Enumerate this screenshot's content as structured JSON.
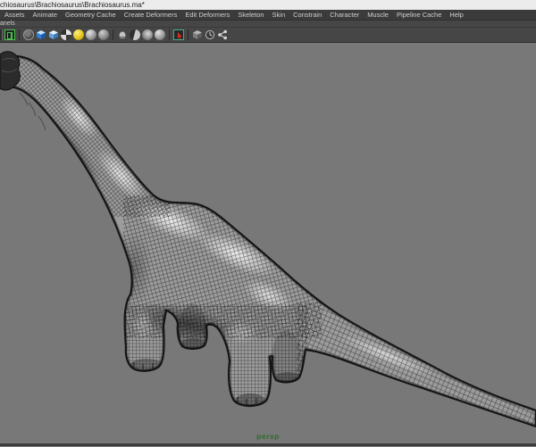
{
  "window": {
    "title": "chiosaurus\\Brachiosaurus\\Brachiosaurus.ma*"
  },
  "menu_bar": {
    "items": [
      "Assets",
      "Animate",
      "Geometry Cache",
      "Create Deformers",
      "Edit Deformers",
      "Skeleton",
      "Skin",
      "Constrain",
      "Character",
      "Muscle",
      "Pipeline Cache",
      "Help"
    ]
  },
  "panel_menu": {
    "visible_label": "anels"
  },
  "panel_toolbar": {
    "icons": [
      "panel-layout-icon",
      "wireframe-sphere-icon",
      "shaded-cube-icon",
      "textured-cube-icon",
      "checker-sphere-icon",
      "all-lights-icon",
      "flat-light-sphere-icon",
      "no-lights-sphere-icon",
      "shadows-lamp-icon",
      "ao-sphere-icon",
      "half-shade-sphere-icon",
      "multisample-sphere-icon",
      "isolate-select-icon",
      "xray-cube-icon",
      "exposure-clock-icon",
      "node-share-icon"
    ]
  },
  "viewport": {
    "camera_label": "persp",
    "model": "brachiosaurus-wireframe-mesh"
  },
  "colors": {
    "titlebar_bg": "#ececec",
    "menu_bg": "#3b3b3b",
    "toolbar_bg": "#464646",
    "viewport_bg": "#787878",
    "accent_green": "#49c24f",
    "persp_label_green": "#2a6e2a",
    "mesh_base_gray": "#9c9c9c"
  }
}
